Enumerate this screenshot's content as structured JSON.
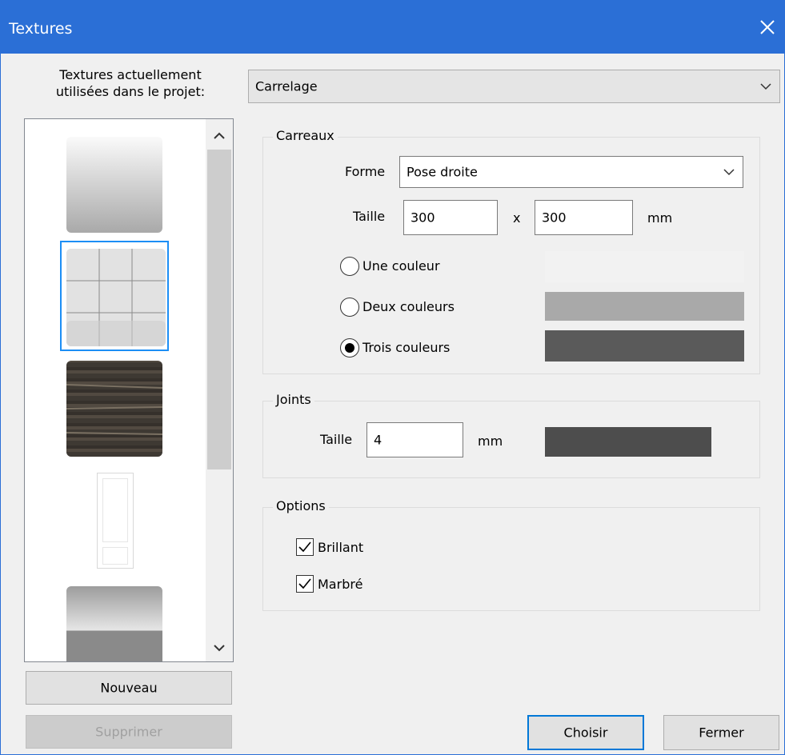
{
  "window": {
    "title": "Textures"
  },
  "left": {
    "list_label_line1": "Textures actuellement",
    "list_label_line2": "utilisées dans le projet:",
    "new_button": "Nouveau",
    "delete_button": "Supprimer"
  },
  "type_select": {
    "value": "Carrelage"
  },
  "tiles_group": {
    "legend": "Carreaux",
    "shape_label": "Forme",
    "shape_value": "Pose droite",
    "size_label": "Taille",
    "width": "300",
    "x_label": "x",
    "height": "300",
    "unit": "mm",
    "color_options": [
      {
        "label": "Une couleur",
        "selected": false,
        "swatch": "#f2f2f2"
      },
      {
        "label": "Deux couleurs",
        "selected": false,
        "swatch": "#a9a9a9"
      },
      {
        "label": "Trois couleurs",
        "selected": true,
        "swatch": "#5a5a5a"
      }
    ]
  },
  "joints_group": {
    "legend": "Joints",
    "size_label": "Taille",
    "size_value": "4",
    "unit": "mm",
    "swatch": "#4d4d4d"
  },
  "options_group": {
    "legend": "Options",
    "brillant": "Brillant",
    "brillant_checked": true,
    "marbre": "Marbré",
    "marbre_checked": true
  },
  "footer": {
    "choose_button": "Choisir",
    "close_button": "Fermer"
  }
}
